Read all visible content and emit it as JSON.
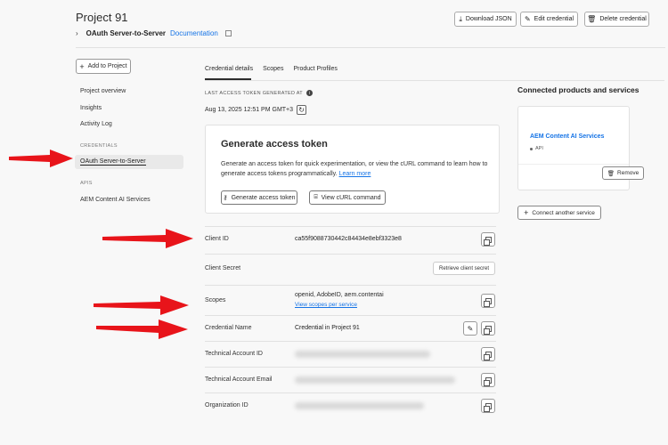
{
  "header": {
    "project_title": "Project 91",
    "credential_name": "OAuth Server-to-Server",
    "documentation_link": "Documentation",
    "download_json": "Download JSON",
    "edit_credential": "Edit credential",
    "delete_credential": "Delete credential"
  },
  "sidebar": {
    "add_to_project": "Add to Project",
    "items": [
      {
        "label": "Project overview"
      },
      {
        "label": "Insights"
      },
      {
        "label": "Activity Log"
      }
    ],
    "credentials_heading": "CREDENTIALS",
    "credential_item": "OAuth Server-to-Server",
    "apis_heading": "APIS",
    "api_item": "AEM Content AI Services"
  },
  "tabs": [
    "Credential details",
    "Scopes",
    "Product Profiles"
  ],
  "token": {
    "last_generated_label": "LAST ACCESS TOKEN GENERATED AT",
    "last_generated_value": "Aug 13, 2025 12:51 PM GMT+3"
  },
  "generate_card": {
    "title": "Generate access token",
    "description": "Generate an access token for quick experimentation, or view the cURL command to learn how to generate access tokens programmatically.",
    "learn_more": "Learn more",
    "generate_button": "Generate access token",
    "curl_button": "View cURL command"
  },
  "fields": {
    "client_id": {
      "label": "Client ID",
      "value": "ca55f9088730442c84434e8ebf3323e8"
    },
    "client_secret": {
      "label": "Client Secret",
      "button": "Retrieve client secret"
    },
    "scopes": {
      "label": "Scopes",
      "value": "openid, AdobeID, aem.contentai",
      "link": "View scopes per service"
    },
    "credential_name": {
      "label": "Credential Name",
      "value": "Credential in Project 91"
    },
    "technical_account_id": {
      "label": "Technical Account ID"
    },
    "technical_account_email": {
      "label": "Technical Account Email"
    },
    "organization_id": {
      "label": "Organization ID"
    }
  },
  "connected": {
    "heading": "Connected products and services",
    "service_name": "AEM Content AI Services",
    "service_type": "API",
    "remove_button": "Remove",
    "connect_button": "Connect another service"
  },
  "colors": {
    "accent": "#1473e6",
    "annotation_arrow": "#e8141a"
  }
}
